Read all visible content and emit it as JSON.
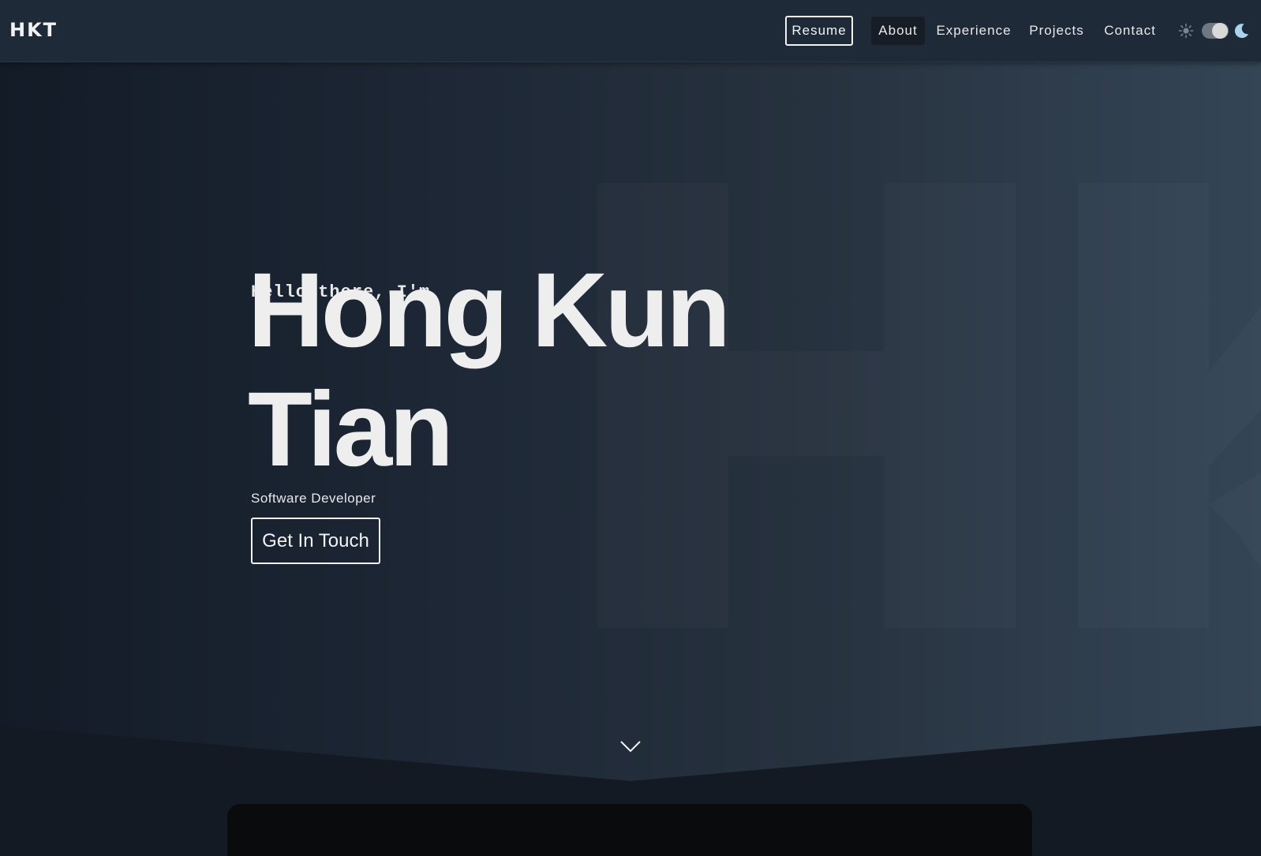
{
  "nav": {
    "brand": "HKT",
    "resume_label": "Resume",
    "links": [
      {
        "label": "About",
        "active": true
      },
      {
        "label": "Experience",
        "active": false
      },
      {
        "label": "Projects",
        "active": false
      },
      {
        "label": "Contact",
        "active": false
      }
    ],
    "theme_toggle": {
      "mode": "dark",
      "sun_icon": "sun-icon",
      "moon_icon": "moon-icon"
    }
  },
  "hero": {
    "greeting": "Hello there, I'm",
    "name_line_1": "Hong Kun",
    "name_line_2": "Tian",
    "role": "Software Developer",
    "cta_label": "Get In Touch",
    "scroll_icon": "chevron-down-icon",
    "watermark": "HK"
  },
  "colors": {
    "navbar_bg": "#1f2a38",
    "hero_gradient_start": "#131b27",
    "hero_gradient_end": "#344556",
    "text": "#eeeeee",
    "section_bg": "#131a24",
    "card_bg": "#0a0b0c",
    "moon": "#a9d4ec"
  }
}
